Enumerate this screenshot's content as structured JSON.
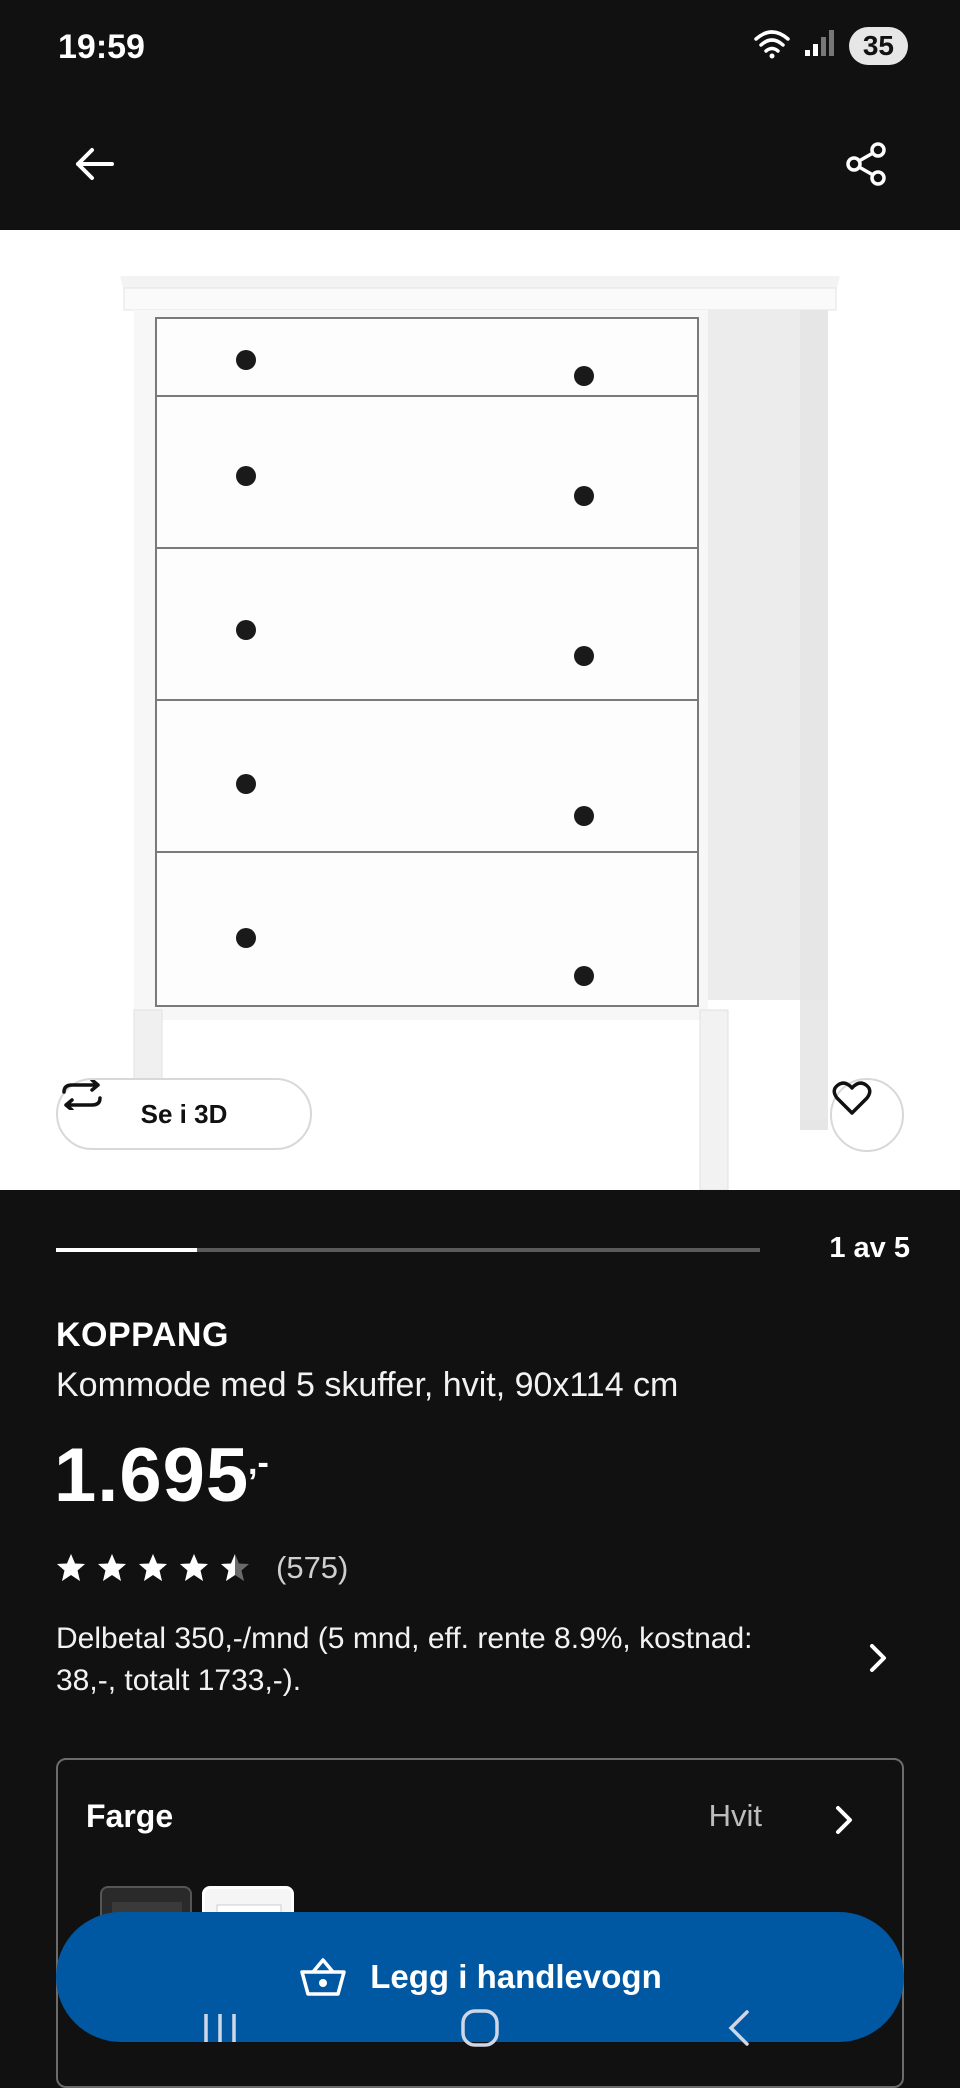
{
  "status_bar": {
    "time": "19:59",
    "battery": "35",
    "icons": [
      "wifi-icon",
      "signal-icon",
      "battery-icon"
    ]
  },
  "app_bar": {
    "back_icon": "arrow-left-icon",
    "share_icon": "share-icon"
  },
  "hero": {
    "see_3d_label": "Se i 3D",
    "see_3d_icon": "rotate-arrows-icon",
    "favorite_icon": "heart-icon",
    "gallery": {
      "current": 1,
      "total": 5,
      "counter_text": "1 av 5"
    }
  },
  "product": {
    "brand": "KOPPANG",
    "description": "Kommode med 5 skuffer, hvit, 90x114 cm",
    "price": "1.695",
    "price_suffix": ",-",
    "rating": {
      "stars": 4.5,
      "max": 5,
      "review_count": "(575)"
    },
    "financing_text": "Delbetal 350,-/mnd (5 mnd, eff. rente 8.9%, kostnad: 38,-, totalt 1733,-).",
    "financing_icon": "chevron-right-icon"
  },
  "color_selector": {
    "label": "Farge",
    "value": "Hvit",
    "icon": "chevron-right-icon",
    "swatches": [
      "dark-swatch",
      "white-swatch"
    ],
    "selected_index": 1
  },
  "cart_button": {
    "label": "Legg i handlevogn",
    "icon": "basket-icon",
    "color": "#0058a3"
  },
  "system_nav": {
    "icons": [
      "recent-apps-icon",
      "home-icon",
      "back-icon"
    ]
  }
}
